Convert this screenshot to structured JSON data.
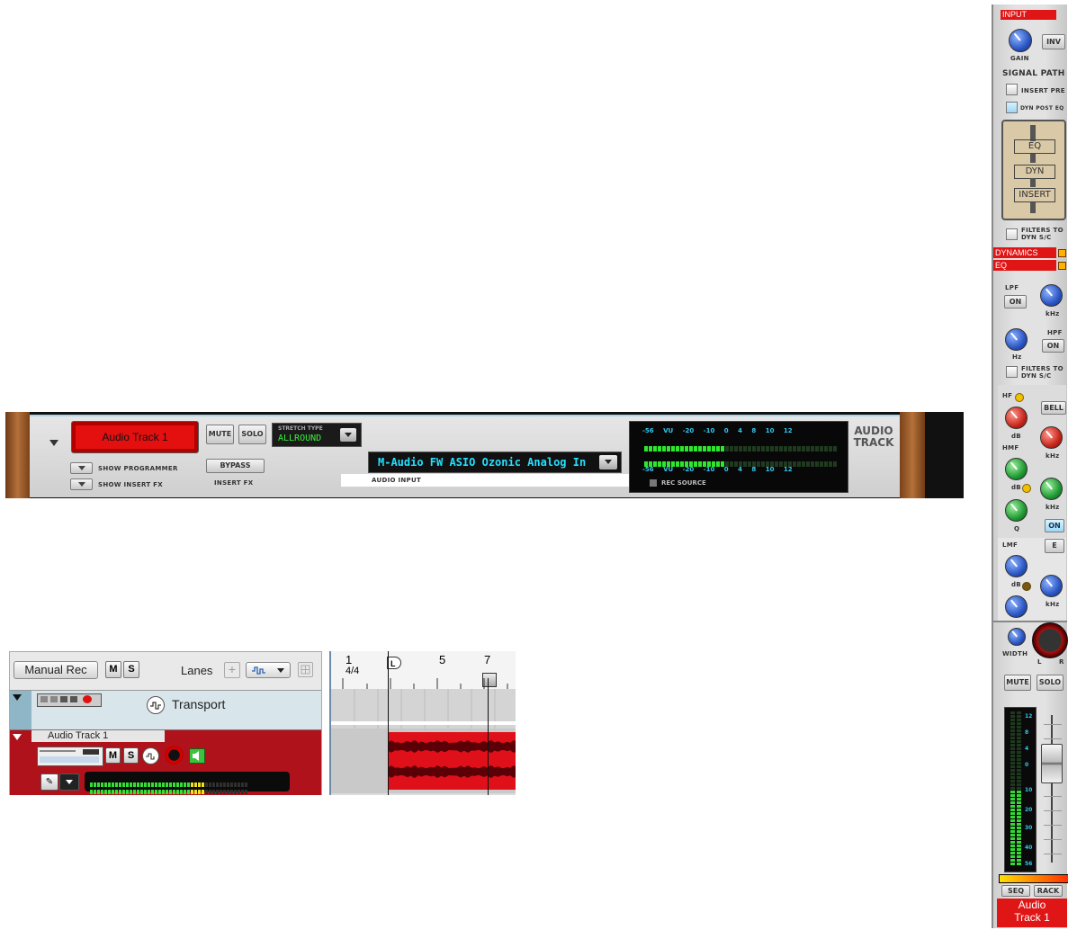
{
  "device": {
    "track_name": "Audio Track 1",
    "mute_label": "MUTE",
    "solo_label": "SOLO",
    "stretch_type_label": "STRETCH TYPE",
    "stretch_type_value": "ALLROUND",
    "show_programmer_label": "SHOW PROGRAMMER",
    "show_insert_fx_label": "SHOW INSERT FX",
    "bypass_label": "BYPASS",
    "insert_fx_label": "INSERT FX",
    "audio_input_value": "M-Audio FW ASIO Ozonic Analog In",
    "audio_input_label": "AUDIO INPUT",
    "meter_scale": [
      "-56",
      "VU",
      "-20",
      "-10",
      "0",
      "4",
      "8",
      "10",
      "12"
    ],
    "rec_source_label": "REC SOURCE",
    "device_title_line1": "AUDIO",
    "device_title_line2": "TRACK"
  },
  "sequencer": {
    "manual_rec_label": "Manual Rec",
    "m_label": "M",
    "s_label": "S",
    "lanes_label": "Lanes",
    "transport_label": "Transport",
    "track_name": "Audio Track 1",
    "ruler_bars": [
      "1",
      "5",
      "7"
    ],
    "time_signature": "4/4",
    "left_locator": "L",
    "clip_color": "#e0101a"
  },
  "mixer": {
    "input_label": "INPUT",
    "gain_label": "GAIN",
    "inv_label": "INV",
    "signal_path_label": "SIGNAL PATH",
    "insert_pre_label": "INSERT PRE",
    "dyn_post_eq_label": "DYN POST EQ",
    "path_eq": "EQ",
    "path_dyn": "DYN",
    "path_insert": "INSERT",
    "filters_to_dyn_label_1": "FILTERS TO DYN S/C",
    "dynamics_label": "DYNAMICS",
    "eq_label": "EQ",
    "lpf_label": "LPF",
    "lpf_on": "ON",
    "khz_label_1": "kHz",
    "hpf_label": "HPF",
    "hpf_on": "ON",
    "hz_label": "Hz",
    "filters_to_dyn_label_2": "FILTERS TO DYN S/C",
    "hf_label": "HF",
    "bell_label": "BELL",
    "db_label_hf": "dB",
    "khz_label_hf": "kHz",
    "hmf_label": "HMF",
    "db_label_hmf": "dB",
    "khz_label_hmf": "kHz",
    "q_label": "Q",
    "eq_on": "ON",
    "lmf_label": "LMF",
    "e_label": "E",
    "db_label_lmf": "dB",
    "khz_label_lmf": "kHz",
    "width_label": "WIDTH",
    "pan_l": "L",
    "pan_r": "R",
    "mute_label": "MUTE",
    "solo_label": "SOLO",
    "fader_scale": [
      "12",
      "8",
      "4",
      "0",
      "10",
      "20",
      "30",
      "40",
      "56"
    ],
    "seq_label": "SEQ",
    "rack_label": "RACK",
    "channel_name_1": "Audio",
    "channel_name_2": "Track 1",
    "accent_red": "#e01515",
    "accent_blue": "#2a55c4",
    "accent_green": "#1f9a33"
  }
}
